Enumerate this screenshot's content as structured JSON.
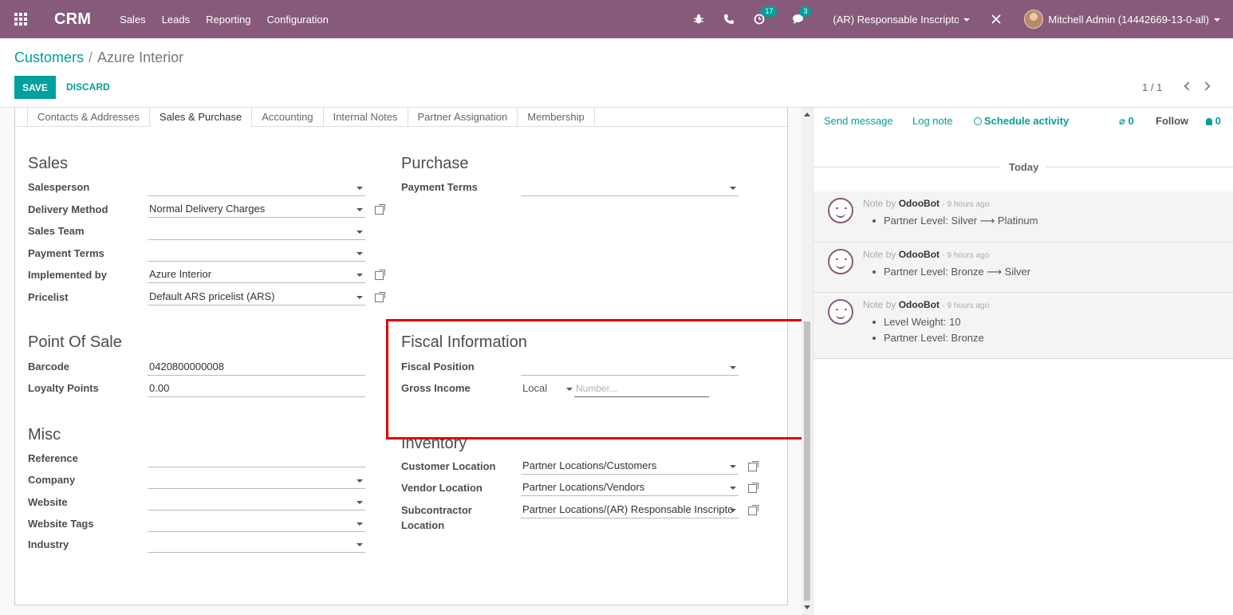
{
  "navbar": {
    "brand": "CRM",
    "menu": [
      "Sales",
      "Leads",
      "Reporting",
      "Configuration"
    ],
    "activity_badge": "17",
    "message_badge": "3",
    "company": "(AR) Responsable Inscripto",
    "user": "Mitchell Admin (14442669-13-0-all)"
  },
  "breadcrumb": {
    "parent": "Customers",
    "separator": "/",
    "current": "Azure Interior"
  },
  "actions": {
    "save": "SAVE",
    "discard": "DISCARD"
  },
  "pager": {
    "value": "1 / 1"
  },
  "tabs": [
    "Contacts & Addresses",
    "Sales & Purchase",
    "Accounting",
    "Internal Notes",
    "Partner Assignation",
    "Membership"
  ],
  "sales": {
    "title": "Sales",
    "fields": [
      {
        "label": "Salesperson",
        "value": ""
      },
      {
        "label": "Delivery Method",
        "value": "Normal Delivery Charges"
      },
      {
        "label": "Sales Team",
        "value": ""
      },
      {
        "label": "Payment Terms",
        "value": ""
      },
      {
        "label": "Implemented by",
        "value": "Azure Interior"
      },
      {
        "label": "Pricelist",
        "value": "Default ARS pricelist (ARS)"
      }
    ]
  },
  "purchase": {
    "title": "Purchase",
    "fields": [
      {
        "label": "Payment Terms",
        "value": ""
      }
    ]
  },
  "pos": {
    "title": "Point Of Sale",
    "fields": [
      {
        "label": "Barcode",
        "value": "0420800000008"
      },
      {
        "label": "Loyalty Points",
        "value": "0.00"
      }
    ]
  },
  "fiscal": {
    "title": "Fiscal Information",
    "fields": [
      {
        "label": "Fiscal Position",
        "value": ""
      },
      {
        "label": "Gross Income",
        "type_value": "Local",
        "number_placeholder": "Number..."
      }
    ]
  },
  "misc": {
    "title": "Misc",
    "fields": [
      {
        "label": "Reference",
        "value": ""
      },
      {
        "label": "Company",
        "value": ""
      },
      {
        "label": "Website",
        "value": ""
      },
      {
        "label": "Website Tags",
        "value": ""
      },
      {
        "label": "Industry",
        "value": ""
      }
    ]
  },
  "inventory": {
    "title": "Inventory",
    "fields": [
      {
        "label": "Customer Location",
        "value": "Partner Locations/Customers"
      },
      {
        "label": "Vendor Location",
        "value": "Partner Locations/Vendors"
      },
      {
        "label": "Subcontractor",
        "label2": "Location",
        "value": "Partner Locations/(AR) Responsable Inscripto"
      }
    ]
  },
  "chatter": {
    "send_message": "Send message",
    "log_note": "Log note",
    "schedule_activity": "Schedule activity",
    "attachments": "0",
    "follow": "Follow",
    "followers": "0",
    "today": "Today",
    "messages": [
      {
        "prefix": "Note by",
        "author": "OdooBot",
        "time": "- 9 hours ago",
        "lines": [
          "Partner Level: Silver ⟶ Platinum"
        ]
      },
      {
        "prefix": "Note by",
        "author": "OdooBot",
        "time": "- 9 hours ago",
        "lines": [
          "Partner Level: Bronze ⟶ Silver"
        ]
      },
      {
        "prefix": "Note by",
        "author": "OdooBot",
        "time": "- 9 hours ago",
        "lines": [
          "Level Weight: 10",
          "Partner Level: Bronze"
        ]
      }
    ]
  },
  "colors": {
    "brand": "#875a7b",
    "accent": "#00a09d",
    "highlight": "#e00000"
  }
}
